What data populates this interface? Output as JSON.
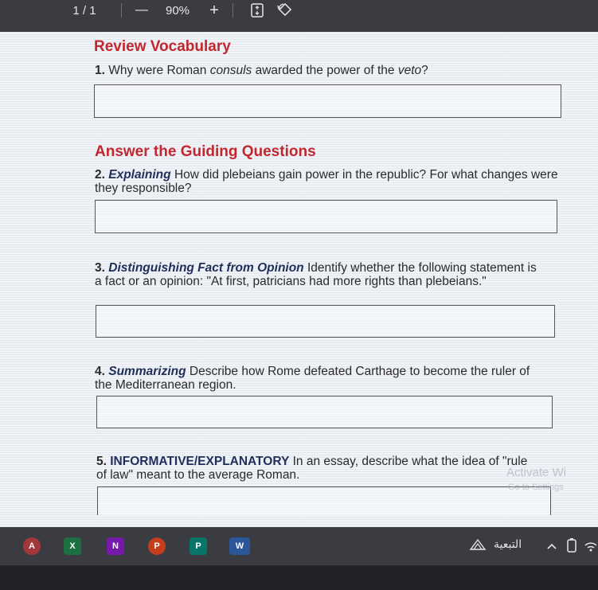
{
  "toolbar": {
    "page_indicator": "1 / 1",
    "zoom_out_label": "—",
    "zoom_level": "90%",
    "zoom_in_label": "+",
    "icons": [
      "fit-page-icon",
      "rotate-icon"
    ]
  },
  "document": {
    "sections": [
      {
        "heading": "Review Vocabulary"
      },
      {
        "heading": "Answer the Guiding Questions"
      }
    ],
    "questions": [
      {
        "number": "1.",
        "text_before": "Why were Roman ",
        "italic_1": "consuls",
        "text_middle": " awarded the power of the ",
        "italic_2": "veto",
        "text_after": "?"
      },
      {
        "number": "2.",
        "keyword": "Explaining",
        "text": "How did plebeians gain power in the republic? For what changes were they responsible?"
      },
      {
        "number": "3.",
        "keyword": "Distinguishing Fact from Opinion",
        "text": "Identify whether the following statement is a fact or an opinion: \"At first, patricians had more rights than plebeians.\""
      },
      {
        "number": "4.",
        "keyword": "Summarizing",
        "text": "Describe how Rome defeated Carthage to become the ruler of the Mediterranean region."
      },
      {
        "number": "5.",
        "keyword": "INFORMATIVE/EXPLANATORY",
        "text": "In an essay, describe what the idea of \"rule of law\" meant to the average Roman."
      }
    ]
  },
  "watermark": {
    "line1": "Activate Wi",
    "line2": "Go to Settings"
  },
  "taskbar": {
    "apps": [
      {
        "name": "access-app",
        "letter": "A",
        "color": "#a4373a"
      },
      {
        "name": "excel-app",
        "letter": "X",
        "color": "#1d6f42"
      },
      {
        "name": "onenote-app",
        "letter": "N",
        "color": "#7719aa"
      },
      {
        "name": "powerpoint-app",
        "letter": "P",
        "color": "#c43e1c"
      },
      {
        "name": "publisher-app",
        "letter": "P",
        "color": "#077568"
      },
      {
        "name": "word-app",
        "letter": "W",
        "color": "#2b579a"
      }
    ],
    "tray_label": "التبعية"
  }
}
